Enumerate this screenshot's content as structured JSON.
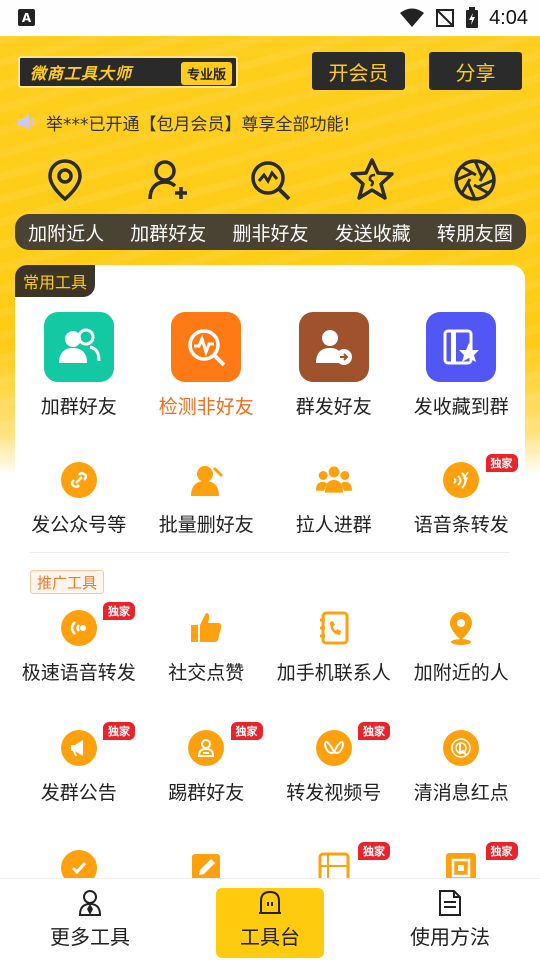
{
  "status_bar": {
    "time": "4:04",
    "a_label": "A"
  },
  "header": {
    "brand_name": "微商工具大师",
    "brand_tag": "专业版",
    "vip_button": "开会员",
    "share_button": "分享",
    "notice": "举***已开通【包月会员】尊享全部功能!"
  },
  "quick_actions": [
    {
      "label": "加附近人",
      "icon": "location-pin-icon"
    },
    {
      "label": "加群好友",
      "icon": "add-user-icon"
    },
    {
      "label": "删非好友",
      "icon": "search-check-icon"
    },
    {
      "label": "发送收藏",
      "icon": "star-icon"
    },
    {
      "label": "转朋友圈",
      "icon": "shutter-icon"
    }
  ],
  "common_tools": {
    "tag": "常用工具",
    "featured": [
      {
        "label": "加群好友",
        "icon": "group-users-icon",
        "color": "#12c9a4"
      },
      {
        "label": "检测非好友",
        "icon": "detect-icon",
        "color": "#ff7a14",
        "highlight": true
      },
      {
        "label": "群发好友",
        "icon": "forward-user-icon",
        "color": "#a0522d"
      },
      {
        "label": "发收藏到群",
        "icon": "collection-star-icon",
        "color": "#5256f5"
      }
    ],
    "row2": [
      {
        "label": "发公众号等",
        "icon": "link-icon"
      },
      {
        "label": "批量删好友",
        "icon": "batch-delete-icon"
      },
      {
        "label": "拉人进群",
        "icon": "group-icon"
      },
      {
        "label": "语音条转发",
        "icon": "voice-icon",
        "badge": "独家"
      }
    ]
  },
  "promo_tools": {
    "tag": "推广工具",
    "row1": [
      {
        "label": "极速语音转发",
        "icon": "fast-voice-icon",
        "badge": "独家"
      },
      {
        "label": "社交点赞",
        "icon": "thumbs-up-icon"
      },
      {
        "label": "加手机联系人",
        "icon": "phone-book-icon"
      },
      {
        "label": "加附近的人",
        "icon": "map-pin-icon"
      }
    ],
    "row2": [
      {
        "label": "发群公告",
        "icon": "megaphone-icon",
        "badge": "独家"
      },
      {
        "label": "踢群好友",
        "icon": "kick-user-icon",
        "badge": "独家"
      },
      {
        "label": "转发视频号",
        "icon": "video-channel-icon",
        "badge": "独家"
      },
      {
        "label": "清消息红点",
        "icon": "tap-icon"
      }
    ],
    "row3": [
      {
        "label": "",
        "icon": "check-icon"
      },
      {
        "label": "",
        "icon": "edit-icon"
      },
      {
        "label": "",
        "icon": "frame-icon",
        "badge": "独家"
      },
      {
        "label": "",
        "icon": "scan-icon",
        "badge": "独家"
      }
    ]
  },
  "bottom_nav": [
    {
      "label": "更多工具",
      "icon": "more-tools-icon"
    },
    {
      "label": "工具台",
      "icon": "bell-icon",
      "active": true
    },
    {
      "label": "使用方法",
      "icon": "document-icon"
    }
  ],
  "colors": {
    "accent": "#ffcb14",
    "dark": "#2b2b2b",
    "highlight": "#f36b1c",
    "badge": "#e8232a",
    "orange_icon": "#ff8a00"
  }
}
